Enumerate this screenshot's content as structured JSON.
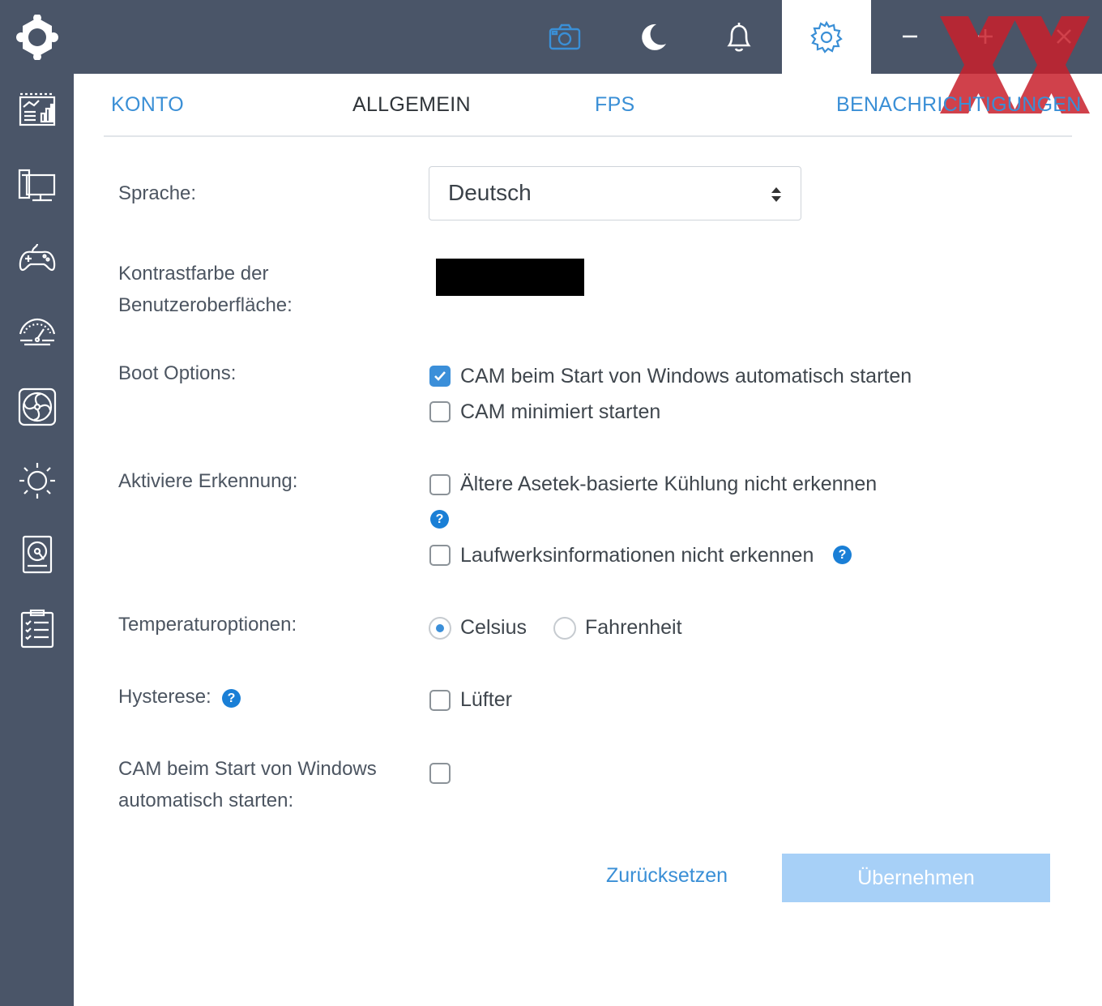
{
  "colors": {
    "chrome": "#4a5568",
    "accent": "#3a8fd6",
    "help": "#1a7fd6",
    "contrast_color": "#000000",
    "apply_bg": "#a7d0f7"
  },
  "topbar": {
    "icons": [
      "camera-icon",
      "moon-icon",
      "bell-icon",
      "gear-icon"
    ],
    "window_controls": [
      "minimize-icon",
      "maximize-icon",
      "close-icon"
    ]
  },
  "sidebar": {
    "items": [
      "dashboard-icon",
      "pc-monitor-icon",
      "gamepad-icon",
      "speedometer-icon",
      "fan-icon",
      "lighting-icon",
      "storage-icon",
      "checklist-icon"
    ]
  },
  "tabs": [
    {
      "label": "KONTO"
    },
    {
      "label": "ALLGEMEIN"
    },
    {
      "label": "FPS"
    },
    {
      "label": "BENACHRICHTIGUNGEN"
    }
  ],
  "settings": {
    "language": {
      "label": "Sprache:",
      "value": "Deutsch"
    },
    "contrast": {
      "label_line1": "Kontrastfarbe der",
      "label_line2": "Benutzeroberfläche:"
    },
    "boot": {
      "label": "Boot Options:",
      "autostart": {
        "text": "CAM beim Start von Windows automatisch starten",
        "checked": true
      },
      "minimized": {
        "text": "CAM minimiert starten",
        "checked": false
      }
    },
    "detection": {
      "label": "Aktiviere Erkennung:",
      "asetek": {
        "text": "Ältere Asetek-basierte Kühlung nicht erkennen",
        "checked": false
      },
      "drives": {
        "text": "Laufwerksinformationen nicht erkennen",
        "checked": false
      }
    },
    "temperature": {
      "label": "Temperaturoptionen:",
      "celsius": "Celsius",
      "fahrenheit": "Fahrenheit",
      "selected": "Celsius"
    },
    "hysteresis": {
      "label": "Hysterese:",
      "fan": {
        "text": "Lüfter",
        "checked": false
      }
    },
    "autostart2": {
      "label_line1": "CAM beim Start von Windows",
      "label_line2": "automatisch starten:",
      "checked": false
    }
  },
  "help_glyph": "?",
  "buttons": {
    "reset": "Zurücksetzen",
    "apply": "Übernehmen"
  }
}
